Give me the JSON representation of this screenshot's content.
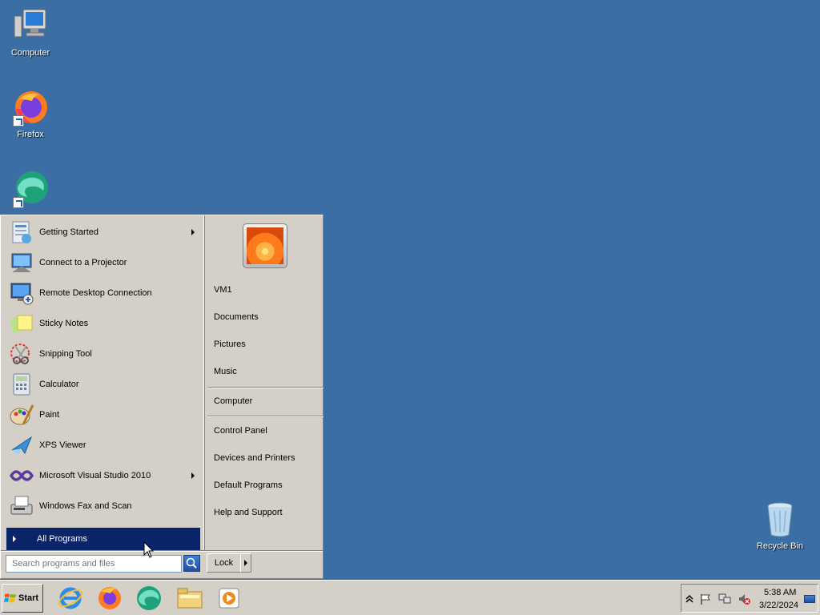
{
  "desktop": {
    "icons": [
      {
        "label": "Computer",
        "icon": "computer-icon"
      },
      {
        "label": "Firefox",
        "icon": "firefox-icon"
      },
      {
        "label": "",
        "icon": "edge-icon"
      },
      {
        "label": "Recycle Bin",
        "icon": "recycle-bin-icon"
      }
    ]
  },
  "start_menu": {
    "programs": [
      {
        "label": "Getting Started",
        "icon": "getting-started-icon",
        "has_submenu": true
      },
      {
        "label": "Connect to a Projector",
        "icon": "projector-icon",
        "has_submenu": false
      },
      {
        "label": "Remote Desktop Connection",
        "icon": "remote-desktop-icon",
        "has_submenu": false
      },
      {
        "label": "Sticky Notes",
        "icon": "sticky-notes-icon",
        "has_submenu": false
      },
      {
        "label": "Snipping Tool",
        "icon": "snipping-tool-icon",
        "has_submenu": false
      },
      {
        "label": "Calculator",
        "icon": "calculator-icon",
        "has_submenu": false
      },
      {
        "label": "Paint",
        "icon": "paint-icon",
        "has_submenu": false
      },
      {
        "label": "XPS Viewer",
        "icon": "xps-viewer-icon",
        "has_submenu": false
      },
      {
        "label": "Microsoft Visual Studio 2010",
        "icon": "visual-studio-icon",
        "has_submenu": true
      },
      {
        "label": "Windows Fax and Scan",
        "icon": "fax-scan-icon",
        "has_submenu": false
      }
    ],
    "all_programs": "All Programs",
    "places": [
      {
        "label": "VM1"
      },
      {
        "label": "Documents"
      },
      {
        "label": "Pictures"
      },
      {
        "label": "Music"
      },
      {
        "label": "Computer"
      },
      {
        "label": "Control Panel"
      },
      {
        "label": "Devices and Printers"
      },
      {
        "label": "Default Programs"
      },
      {
        "label": "Help and Support"
      }
    ],
    "search_placeholder": "Search programs and files",
    "lock_label": "Lock"
  },
  "taskbar": {
    "start_label": "Start",
    "apps": [
      "internet-explorer-icon",
      "firefox-icon",
      "edge-icon",
      "explorer-icon",
      "media-player-icon"
    ],
    "tray_icons": [
      "show-hidden-icon",
      "action-center-flag-icon",
      "network-icon",
      "volume-muted-icon"
    ],
    "clock_time": "5:38 AM",
    "clock_date": "3/22/2024"
  },
  "colors": {
    "desktop": "#3a6ea5",
    "highlight": "#0a246a",
    "chrome": "#d4d0c8"
  }
}
